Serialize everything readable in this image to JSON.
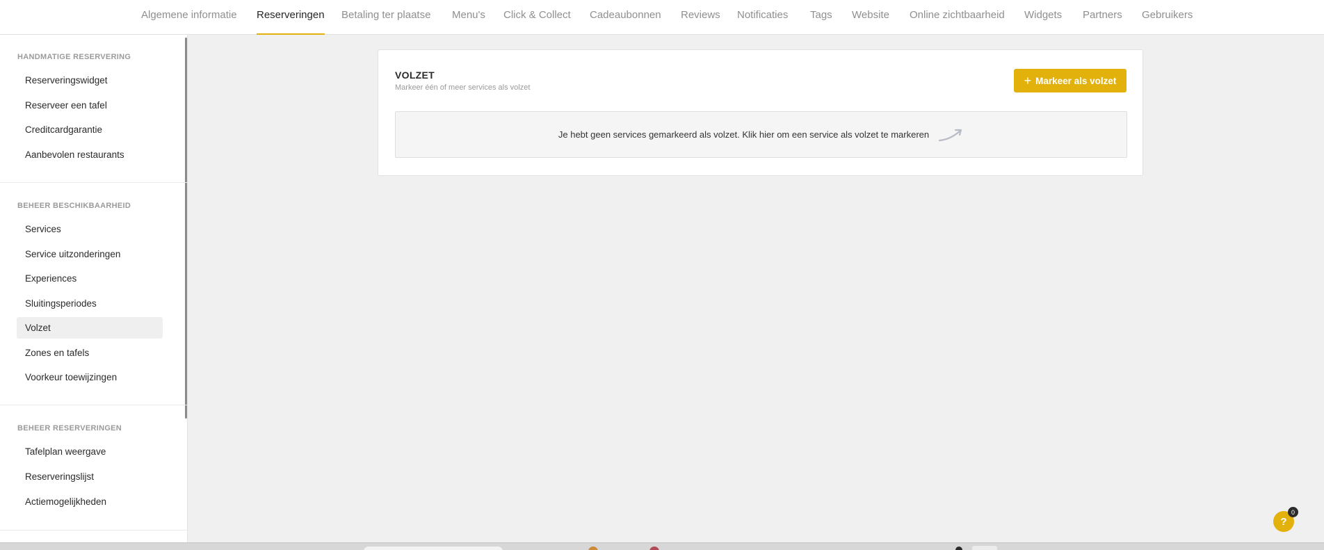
{
  "topnav": {
    "tabs": [
      {
        "label": "Algemene informatie"
      },
      {
        "label": "Reserveringen"
      },
      {
        "label": "Betaling ter plaatse"
      },
      {
        "label": "Menu's"
      },
      {
        "label": "Click & Collect"
      },
      {
        "label": "Cadeaubonnen"
      },
      {
        "label": "Reviews"
      },
      {
        "label": "Notificaties"
      },
      {
        "label": "Tags"
      },
      {
        "label": "Website"
      },
      {
        "label": "Online zichtbaarheid"
      },
      {
        "label": "Widgets"
      },
      {
        "label": "Partners"
      },
      {
        "label": "Gebruikers"
      }
    ],
    "active_tab": "Reserveringen"
  },
  "sidebar": {
    "sections": [
      {
        "heading": "HANDMATIGE RESERVERING",
        "items": [
          "Reserveringswidget",
          "Reserveer een tafel",
          "Creditcardgarantie",
          "Aanbevolen restaurants"
        ]
      },
      {
        "heading": "BEHEER BESCHIKBAARHEID",
        "items": [
          "Services",
          "Service uitzonderingen",
          "Experiences",
          "Sluitingsperiodes",
          "Volzet",
          "Zones en tafels",
          "Voorkeur toewijzingen"
        ]
      },
      {
        "heading": "BEHEER RESERVERINGEN",
        "items": [
          "Tafelplan weergave",
          "Reserveringslijst",
          "Actiemogelijkheden"
        ]
      }
    ],
    "active_item": "Volzet"
  },
  "card": {
    "title": "VOLZET",
    "subtitle": "Markeer één of meer services als volzet",
    "button_label": "Markeer als volzet",
    "button_icon": "plus-icon",
    "empty_message": "Je hebt geen services gemarkeerd als volzet. Klik hier om een service als volzet te markeren",
    "empty_icon": "curved-arrow-icon"
  },
  "help": {
    "label": "?",
    "badge_count": "0"
  },
  "colors": {
    "accent": "#e2b10b",
    "background": "#f0f0f0",
    "active_sidebar_bg": "#efefef"
  }
}
